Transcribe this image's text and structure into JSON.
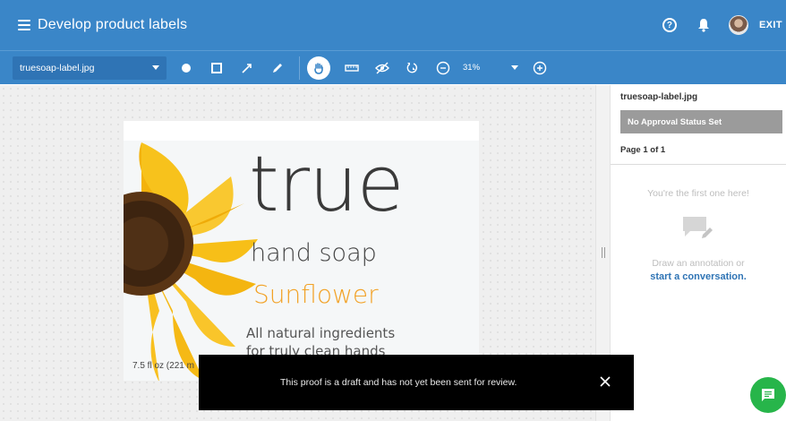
{
  "header": {
    "title": "Develop product labels",
    "exit_label": "EXIT",
    "color": "#3a86c8"
  },
  "toolbar": {
    "file_name": "truesoap-label.jpg",
    "zoom": "31%",
    "tools": [
      "circle-tool-icon",
      "rectangle-tool-icon",
      "arrow-tool-icon",
      "pencil-tool-icon",
      "hand-tool-icon",
      "ruler-icon",
      "hide-annotations-icon",
      "rotate-icon",
      "zoom-out-icon",
      "zoom-in-icon"
    ]
  },
  "label": {
    "brand": "true",
    "subtitle": "hand soap",
    "scent": "Sunflower",
    "tagline_1": "All natural ingredients",
    "tagline_2": "for truly clean hands",
    "volume": "7.5 fl oz (221 m"
  },
  "panel": {
    "file_name": "truesoap-label.jpg",
    "approval_status": "No Approval Status Set",
    "page_info": "Page 1 of 1",
    "empty_title": "You're the first one here!",
    "empty_text": "Draw an annotation or",
    "empty_link": "start a conversation."
  },
  "toast": {
    "message": "This proof is a draft and has not yet been sent for review."
  },
  "colors": {
    "accent": "#3a86c8",
    "chat_button": "#27b54a",
    "scent": "#f2a227"
  }
}
